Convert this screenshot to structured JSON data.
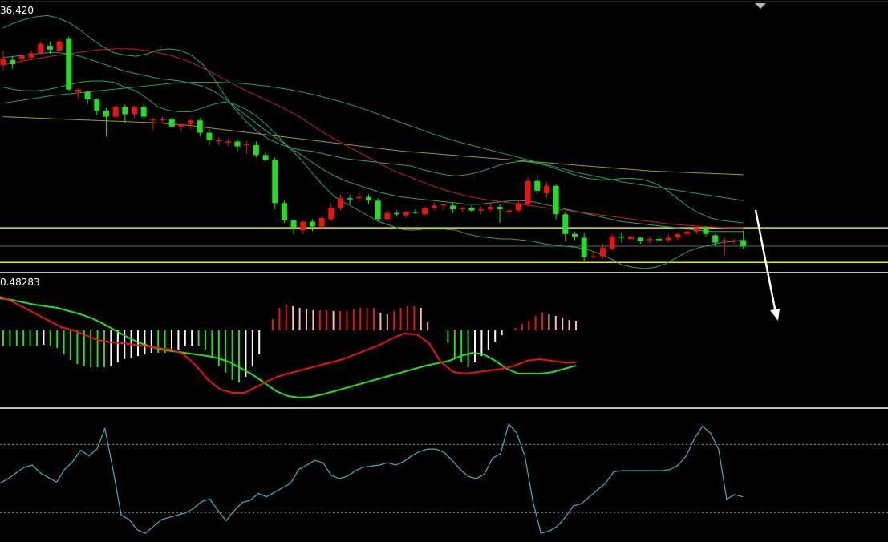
{
  "chart_data": [
    {
      "type": "candlestick",
      "title": "",
      "price_label": "36,420",
      "grid": false,
      "candles": [
        {
          "o": 36330,
          "h": 36342,
          "l": 36312,
          "c": 36320,
          "bull": false
        },
        {
          "o": 36321,
          "h": 36334,
          "l": 36314,
          "c": 36328,
          "bull": true
        },
        {
          "o": 36335,
          "h": 36336,
          "l": 36322,
          "c": 36329,
          "bull": false
        },
        {
          "o": 36339,
          "h": 36343,
          "l": 36328,
          "c": 36332,
          "bull": false
        },
        {
          "o": 36354,
          "h": 36358,
          "l": 36336,
          "c": 36339,
          "bull": false
        },
        {
          "o": 36351,
          "h": 36358,
          "l": 36338,
          "c": 36345,
          "bull": true
        },
        {
          "o": 36343,
          "h": 36362,
          "l": 36339,
          "c": 36358,
          "bull": false
        },
        {
          "o": 36362,
          "h": 36366,
          "l": 36278,
          "c": 36280,
          "bull": true
        },
        {
          "o": 36280,
          "h": 36282,
          "l": 36266,
          "c": 36276,
          "bull": false
        },
        {
          "o": 36276,
          "h": 36278,
          "l": 36256,
          "c": 36264,
          "bull": true
        },
        {
          "o": 36264,
          "h": 36266,
          "l": 36238,
          "c": 36246,
          "bull": true
        },
        {
          "o": 36246,
          "h": 36250,
          "l": 36204,
          "c": 36236,
          "bull": true
        },
        {
          "o": 36236,
          "h": 36256,
          "l": 36230,
          "c": 36252,
          "bull": false
        },
        {
          "o": 36252,
          "h": 36256,
          "l": 36226,
          "c": 36240,
          "bull": true
        },
        {
          "o": 36240,
          "h": 36254,
          "l": 36234,
          "c": 36252,
          "bull": false
        },
        {
          "o": 36252,
          "h": 36256,
          "l": 36232,
          "c": 36236,
          "bull": true
        },
        {
          "o": 36230,
          "h": 36234,
          "l": 36214,
          "c": 36232,
          "bull": false
        },
        {
          "o": 36232,
          "h": 36236,
          "l": 36226,
          "c": 36230,
          "bull": false
        },
        {
          "o": 36232,
          "h": 36236,
          "l": 36218,
          "c": 36220,
          "bull": true
        },
        {
          "o": 36220,
          "h": 36226,
          "l": 36212,
          "c": 36224,
          "bull": false
        },
        {
          "o": 36224,
          "h": 36232,
          "l": 36216,
          "c": 36230,
          "bull": false
        },
        {
          "o": 36230,
          "h": 36234,
          "l": 36204,
          "c": 36210,
          "bull": true
        },
        {
          "o": 36210,
          "h": 36216,
          "l": 36190,
          "c": 36198,
          "bull": true
        },
        {
          "o": 36198,
          "h": 36202,
          "l": 36190,
          "c": 36196,
          "bull": false
        },
        {
          "o": 36196,
          "h": 36200,
          "l": 36188,
          "c": 36194,
          "bull": false
        },
        {
          "o": 36196,
          "h": 36200,
          "l": 36180,
          "c": 36188,
          "bull": true
        },
        {
          "o": 36190,
          "h": 36198,
          "l": 36176,
          "c": 36192,
          "bull": false
        },
        {
          "o": 36190,
          "h": 36196,
          "l": 36170,
          "c": 36174,
          "bull": true
        },
        {
          "o": 36174,
          "h": 36178,
          "l": 36164,
          "c": 36166,
          "bull": true
        },
        {
          "o": 36166,
          "h": 36170,
          "l": 36086,
          "c": 36096,
          "bull": true
        },
        {
          "o": 36096,
          "h": 36100,
          "l": 36064,
          "c": 36068,
          "bull": true
        },
        {
          "o": 36068,
          "h": 36070,
          "l": 36046,
          "c": 36056,
          "bull": true
        },
        {
          "o": 36052,
          "h": 36068,
          "l": 36046,
          "c": 36066,
          "bull": false
        },
        {
          "o": 36066,
          "h": 36070,
          "l": 36050,
          "c": 36058,
          "bull": true
        },
        {
          "o": 36058,
          "h": 36076,
          "l": 36054,
          "c": 36072,
          "bull": false
        },
        {
          "o": 36070,
          "h": 36096,
          "l": 36066,
          "c": 36088,
          "bull": false
        },
        {
          "o": 36088,
          "h": 36110,
          "l": 36084,
          "c": 36104,
          "bull": false
        },
        {
          "o": 36102,
          "h": 36110,
          "l": 36094,
          "c": 36104,
          "bull": true
        },
        {
          "o": 36104,
          "h": 36112,
          "l": 36098,
          "c": 36106,
          "bull": false
        },
        {
          "o": 36106,
          "h": 36110,
          "l": 36094,
          "c": 36100,
          "bull": true
        },
        {
          "o": 36100,
          "h": 36104,
          "l": 36066,
          "c": 36070,
          "bull": true
        },
        {
          "o": 36070,
          "h": 36084,
          "l": 36066,
          "c": 36080,
          "bull": false
        },
        {
          "o": 36080,
          "h": 36084,
          "l": 36074,
          "c": 36078,
          "bull": true
        },
        {
          "o": 36076,
          "h": 36084,
          "l": 36072,
          "c": 36082,
          "bull": false
        },
        {
          "o": 36082,
          "h": 36086,
          "l": 36078,
          "c": 36080,
          "bull": true
        },
        {
          "o": 36078,
          "h": 36090,
          "l": 36076,
          "c": 36088,
          "bull": false
        },
        {
          "o": 36088,
          "h": 36098,
          "l": 36084,
          "c": 36092,
          "bull": false
        },
        {
          "o": 36092,
          "h": 36096,
          "l": 36084,
          "c": 36094,
          "bull": false
        },
        {
          "o": 36092,
          "h": 36096,
          "l": 36080,
          "c": 36086,
          "bull": true
        },
        {
          "o": 36086,
          "h": 36090,
          "l": 36082,
          "c": 36088,
          "bull": false
        },
        {
          "o": 36088,
          "h": 36092,
          "l": 36082,
          "c": 36084,
          "bull": true
        },
        {
          "o": 36084,
          "h": 36090,
          "l": 36078,
          "c": 36086,
          "bull": false
        },
        {
          "o": 36086,
          "h": 36096,
          "l": 36082,
          "c": 36090,
          "bull": false
        },
        {
          "o": 36090,
          "h": 36094,
          "l": 36064,
          "c": 36086,
          "bull": true
        },
        {
          "o": 36082,
          "h": 36088,
          "l": 36078,
          "c": 36084,
          "bull": false
        },
        {
          "o": 36084,
          "h": 36100,
          "l": 36080,
          "c": 36096,
          "bull": false
        },
        {
          "o": 36094,
          "h": 36138,
          "l": 36090,
          "c": 36132,
          "bull": false
        },
        {
          "o": 36132,
          "h": 36142,
          "l": 36110,
          "c": 36116,
          "bull": true
        },
        {
          "o": 36112,
          "h": 36130,
          "l": 36104,
          "c": 36124,
          "bull": false
        },
        {
          "o": 36124,
          "h": 36126,
          "l": 36070,
          "c": 36078,
          "bull": true
        },
        {
          "o": 36078,
          "h": 36082,
          "l": 36034,
          "c": 36046,
          "bull": true
        },
        {
          "o": 36046,
          "h": 36050,
          "l": 36036,
          "c": 36042,
          "bull": true
        },
        {
          "o": 36040,
          "h": 36048,
          "l": 36002,
          "c": 36008,
          "bull": true
        },
        {
          "o": 36008,
          "h": 36016,
          "l": 36006,
          "c": 36010,
          "bull": false
        },
        {
          "o": 36010,
          "h": 36030,
          "l": 36006,
          "c": 36024,
          "bull": false
        },
        {
          "o": 36022,
          "h": 36046,
          "l": 36018,
          "c": 36042,
          "bull": false
        },
        {
          "o": 36042,
          "h": 36048,
          "l": 36032,
          "c": 36040,
          "bull": true
        },
        {
          "o": 36038,
          "h": 36044,
          "l": 36036,
          "c": 36042,
          "bull": false
        },
        {
          "o": 36040,
          "h": 36042,
          "l": 36030,
          "c": 36034,
          "bull": true
        },
        {
          "o": 36036,
          "h": 36042,
          "l": 36030,
          "c": 36038,
          "bull": false
        },
        {
          "o": 36038,
          "h": 36044,
          "l": 36034,
          "c": 36036,
          "bull": true
        },
        {
          "o": 36036,
          "h": 36046,
          "l": 36032,
          "c": 36040,
          "bull": false
        },
        {
          "o": 36040,
          "h": 36048,
          "l": 36036,
          "c": 36046,
          "bull": false
        },
        {
          "o": 36046,
          "h": 36054,
          "l": 36042,
          "c": 36050,
          "bull": false
        },
        {
          "o": 36050,
          "h": 36058,
          "l": 36046,
          "c": 36056,
          "bull": false
        },
        {
          "o": 36056,
          "h": 36058,
          "l": 36042,
          "c": 36046,
          "bull": true
        },
        {
          "o": 36044,
          "h": 36046,
          "l": 36026,
          "c": 36032,
          "bull": true
        },
        {
          "o": 36036,
          "h": 36040,
          "l": 36012,
          "c": 36034,
          "bull": false
        },
        {
          "o": 36034,
          "h": 36038,
          "l": 36030,
          "c": 36036,
          "bull": false
        },
        {
          "o": 36036,
          "h": 36052,
          "l": 36022,
          "c": 36026,
          "bull": true
        }
      ],
      "bollinger_upper": [
        36380,
        36388,
        36394,
        36398,
        36400,
        36396,
        36388,
        36376,
        36362,
        36350,
        36340,
        36336,
        36334,
        36338,
        36344,
        36346,
        36344,
        36336,
        36322,
        36300,
        36272,
        36248,
        36228,
        36212,
        36200,
        36192,
        36186,
        36182,
        36180,
        36176,
        36172,
        36168,
        36166,
        36164,
        36162,
        36160,
        36158,
        36156,
        36150,
        36146,
        36142,
        36140,
        36142,
        36146,
        36152,
        36158,
        36162,
        36164,
        36162,
        36158,
        36152,
        36146,
        36140,
        36136,
        36134,
        36134,
        36136,
        36136,
        36134,
        36128,
        36118,
        36104,
        36090,
        36080,
        36072,
        36068,
        36066,
        36064
      ],
      "bollinger_mid": [
        36332,
        36334,
        36336,
        36338,
        36340,
        36340,
        36338,
        36334,
        36328,
        36322,
        36316,
        36310,
        36306,
        36302,
        36298,
        36296,
        36294,
        36290,
        36286,
        36278,
        36266,
        36252,
        36238,
        36224,
        36210,
        36198,
        36186,
        36174,
        36162,
        36150,
        36140,
        36132,
        36126,
        36120,
        36114,
        36110,
        36106,
        36104,
        36102,
        36100,
        36098,
        36096,
        36094,
        36094,
        36096,
        36098,
        36100,
        36100,
        36098,
        36094,
        36090,
        36086,
        36082,
        36078,
        36074,
        36070,
        36066,
        36064,
        36062,
        36060,
        36058,
        36056,
        36054,
        36052,
        36050,
        36050,
        36050,
        36050
      ],
      "bollinger_lower": [
        36284,
        36280,
        36278,
        36278,
        36280,
        36284,
        36288,
        36292,
        36294,
        36294,
        36292,
        36284,
        36278,
        36266,
        36252,
        36246,
        36244,
        36244,
        36250,
        36256,
        36260,
        36256,
        36248,
        36236,
        36220,
        36202,
        36184,
        36166,
        36144,
        36124,
        36106,
        36096,
        36086,
        36076,
        36066,
        36060,
        36054,
        36052,
        36054,
        36054,
        36054,
        36052,
        36046,
        36042,
        36040,
        36038,
        36038,
        36036,
        36034,
        36030,
        36028,
        36026,
        36024,
        36020,
        36014,
        36006,
        35996,
        35992,
        35990,
        35992,
        35998,
        36008,
        36018,
        36024,
        36028,
        36032,
        36034,
        36036
      ],
      "ma_red": [
        36320,
        36326,
        36331,
        36336,
        36340,
        36344,
        36346,
        36346,
        36342,
        36336,
        36326,
        36312,
        36296,
        36280,
        36266,
        36252,
        36236,
        36216,
        36198,
        36182,
        36166,
        36150,
        36138,
        36126,
        36116,
        36108,
        36102,
        36098,
        36094,
        36090,
        36086,
        36082,
        36078,
        36074,
        36070,
        36066,
        36062,
        36060,
        36058,
        36056,
        36056
      ],
      "ma_green": [
        36258,
        36264,
        36270,
        36274,
        36278,
        36282,
        36286,
        36290,
        36292,
        36292,
        36290,
        36286,
        36280,
        36272,
        36262,
        36250,
        36236,
        36222,
        36208,
        36196,
        36186,
        36176,
        36166,
        36156,
        36146,
        36138,
        36130,
        36124,
        36118,
        36112,
        36106,
        36100
      ],
      "ma_yellow": [
        36236,
        36234,
        36232,
        36230,
        36228,
        36226,
        36222,
        36216,
        36210,
        36204,
        36198,
        36192,
        36186,
        36180,
        36176,
        36172,
        36168,
        36164,
        36160,
        36156,
        36152,
        36148,
        36146,
        36144,
        36142
      ],
      "hlines": [
        36056,
        36000
      ]
    },
    {
      "type": "macd",
      "title": "",
      "value_label": "0.48283",
      "histogram": [
        -20,
        -20,
        -20,
        -20,
        -20,
        -20,
        -18,
        -19,
        -22,
        -30,
        -37,
        -42,
        -44,
        -46,
        -46,
        -46,
        -44,
        -40,
        -36,
        -34,
        -32,
        -30,
        -28,
        -28,
        -28,
        -26,
        -24,
        -20,
        -19,
        -20,
        -24,
        -34,
        -45,
        -53,
        -62,
        -65,
        -58,
        -45,
        -30,
        0,
        14,
        28,
        32,
        30,
        28,
        26,
        25,
        25,
        25,
        24,
        24,
        24,
        26,
        28,
        28,
        28,
        22,
        20,
        24,
        28,
        30,
        30,
        28,
        10,
        0,
        0,
        -15,
        -34,
        -40,
        -46,
        -40,
        -32,
        -24,
        -14,
        -6,
        0,
        3,
        8,
        12,
        18,
        22,
        20,
        18,
        16,
        13,
        12
      ],
      "signal_green": [
        40,
        38,
        35,
        32,
        30,
        28,
        24,
        20,
        15,
        8,
        0,
        -8,
        -15,
        -20,
        -24,
        -26,
        -28,
        -30,
        -32,
        -35,
        -40,
        -48,
        -56,
        -66,
        -76,
        -82,
        -84,
        -83,
        -80,
        -76,
        -72,
        -68,
        -64,
        -60,
        -56,
        -52,
        -48,
        -44,
        -41,
        -38,
        -32,
        -28,
        -30,
        -38,
        -48,
        -54,
        -54,
        -54,
        -52,
        -48,
        -44
      ],
      "macd_red": [
        42,
        36,
        28,
        20,
        12,
        4,
        0,
        -6,
        -12,
        -15,
        -16,
        -18,
        -20,
        -22,
        -24,
        -30,
        -44,
        -62,
        -74,
        -78,
        -78,
        -70,
        -62,
        -56,
        -52,
        -48,
        -44,
        -40,
        -36,
        -30,
        -24,
        -18,
        -10,
        -4,
        -5,
        -16,
        -40,
        -52,
        -54,
        -52,
        -50,
        -48,
        -44,
        -38,
        -36,
        -38,
        -40,
        -40
      ]
    },
    {
      "type": "line",
      "title": "",
      "ylim": [
        0,
        100
      ],
      "levels": [
        80,
        20
      ],
      "values": [
        46,
        50,
        55,
        60,
        62,
        55,
        51,
        47,
        58,
        65,
        75,
        70,
        76,
        94,
        58,
        18,
        14,
        5,
        2,
        8,
        14,
        16,
        18,
        20,
        24,
        30,
        32,
        22,
        13,
        22,
        29,
        31,
        37,
        34,
        38,
        42,
        46,
        58,
        62,
        66,
        64,
        53,
        50,
        52,
        57,
        60,
        61,
        62,
        64,
        62,
        65,
        70,
        74,
        76,
        76,
        73,
        66,
        58,
        52,
        50,
        54,
        68,
        72,
        98,
        90,
        70,
        30,
        2,
        4,
        8,
        16,
        26,
        28,
        34,
        40,
        46,
        56,
        57,
        57,
        57,
        57,
        57,
        57,
        58,
        62,
        70,
        85,
        96,
        90,
        76,
        32,
        36,
        34
      ],
      "bull_color": "#22dd22",
      "bear_color": "#ee1111"
    }
  ],
  "colors": {
    "background": "#000000",
    "bull": "#22dd22",
    "bear": "#ee1111",
    "bollinger": "#1fa27a",
    "ma_red": "#c42020",
    "ma_green": "#1fa05a",
    "ma_yellow": "#a09a10",
    "hline": "#e8e800",
    "separator": "#bdbdbd",
    "hist_pos_strong": "#ee1111",
    "hist_pos_weak": "#ffb6c1",
    "hist_neg_strong": "#22dd22",
    "hist_neg_weak": "#ffffff",
    "macd_red": "#ee1111",
    "signal_green": "#22dd22",
    "oscillator": "#3bb3c3",
    "level_dots": "#888888",
    "arrow": "#ffffff",
    "marker": "#a9b8c6"
  }
}
